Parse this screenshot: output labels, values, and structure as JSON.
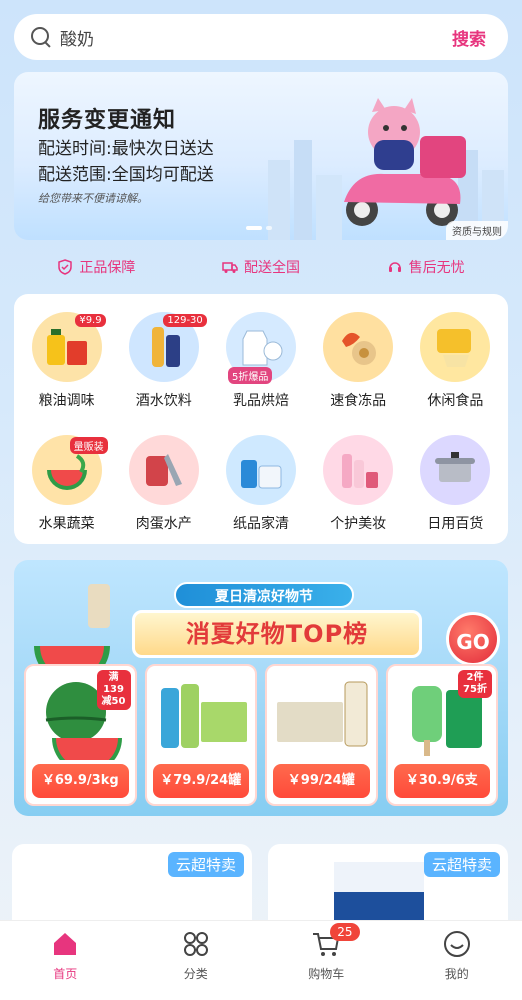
{
  "search": {
    "placeholder": "酸奶",
    "button": "搜索"
  },
  "banner": {
    "title": "服务变更通知",
    "line1": "配送时间:最快次日送达",
    "line2": "配送范围:全国均可配送",
    "note": "给您带来不便请谅解。",
    "rules_link": "资质与规则"
  },
  "services": [
    {
      "label": "正品保障",
      "icon": "shield-icon"
    },
    {
      "label": "配送全国",
      "icon": "truck-icon"
    },
    {
      "label": "售后无忧",
      "icon": "support-icon"
    }
  ],
  "categories": [
    {
      "label": "粮油调味",
      "tag": "¥9.9"
    },
    {
      "label": "酒水饮料",
      "tag": "129-30"
    },
    {
      "label": "乳品烘焙",
      "tag": "5折爆品"
    },
    {
      "label": "速食冻品",
      "tag": ""
    },
    {
      "label": "休闲食品",
      "tag": ""
    },
    {
      "label": "水果蔬菜",
      "tag": "量贩装"
    },
    {
      "label": "肉蛋水产",
      "tag": ""
    },
    {
      "label": "纸品家清",
      "tag": ""
    },
    {
      "label": "个护美妆",
      "tag": ""
    },
    {
      "label": "日用百货",
      "tag": ""
    }
  ],
  "promo": {
    "festival": "夏日清凉好物节",
    "headline": "消夏好物TOP榜",
    "go": "GO",
    "deals": [
      {
        "price": "￥69.9/3kg",
        "badge_line1": "满139",
        "badge_line2": "减50"
      },
      {
        "price": "￥79.9/24罐",
        "badge_line1": "",
        "badge_line2": ""
      },
      {
        "price": "￥99/24罐",
        "badge_line1": "",
        "badge_line2": ""
      },
      {
        "price": "￥30.9/6支",
        "badge_line1": "2件",
        "badge_line2": "75折"
      }
    ]
  },
  "cards": [
    {
      "tag": "云超特卖"
    },
    {
      "tag": "云超特卖"
    }
  ],
  "tabbar": [
    {
      "label": "首页",
      "active": true
    },
    {
      "label": "分类",
      "active": false
    },
    {
      "label": "购物车",
      "active": false,
      "badge": "25"
    },
    {
      "label": "我的",
      "active": false
    }
  ],
  "colors": {
    "accent": "#e7357e",
    "price_red": "#ff4a3a",
    "promo_blue": "#86cdf2"
  }
}
